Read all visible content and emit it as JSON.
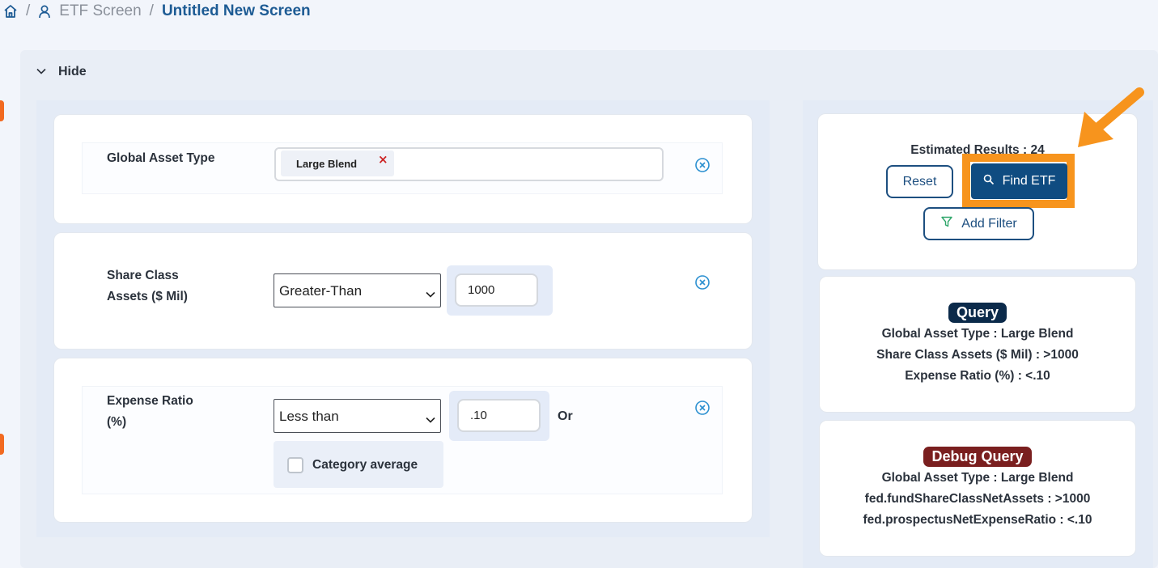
{
  "breadcrumb": {
    "home_icon": "home-icon",
    "user_icon": "user-icon",
    "separator": "/",
    "parent": "ETF Screen",
    "current": "Untitled New Screen"
  },
  "toggle": {
    "label": "Hide",
    "icon": "chevron-down-icon"
  },
  "filters": [
    {
      "label_line1": "Global Asset Type",
      "chips": [
        {
          "label": "Large Blend",
          "remove": "×"
        }
      ]
    },
    {
      "label_line1": "Share Class",
      "label_line2": "Assets ($ Mil)",
      "operator": "Greater-Than",
      "value": "1000"
    },
    {
      "label_line1": "Expense Ratio",
      "label_line2": "(%)",
      "operator": "Less than",
      "value": ".10",
      "or_label": "Or",
      "checkbox_label": "Category average",
      "checkbox_checked": false
    }
  ],
  "actions": {
    "estimated_results": "Estimated Results : 24",
    "reset_label": "Reset",
    "find_label": "Find ETF",
    "add_filter_label": "Add Filter",
    "highlight_color": "#f7941d"
  },
  "query": {
    "title": "Query",
    "title_color": "#0b2a4a",
    "lines": [
      "Global Asset Type : Large Blend",
      "Share Class Assets ($ Mil) : >1000",
      "Expense Ratio (%) : <.10"
    ]
  },
  "debug_query": {
    "title": "Debug Query",
    "title_color": "#7a1f1f",
    "lines": [
      "Global Asset Type : Large Blend",
      "fed.fundShareClassNetAssets : >1000",
      "fed.prospectusNetExpenseRatio : <.10"
    ]
  },
  "colors": {
    "accent": "#0f4c81",
    "link": "#1d5b94",
    "orange": "#f26a21"
  }
}
